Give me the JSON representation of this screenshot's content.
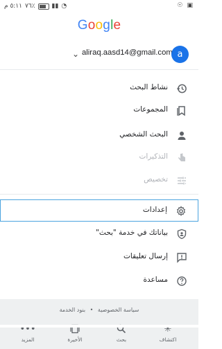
{
  "status_bar": {
    "time_label": "٥:١١ م",
    "battery_label": "٧٦٪"
  },
  "logo": {
    "letters": [
      "G",
      "o",
      "o",
      "g",
      "l",
      "e"
    ],
    "colors": [
      "#4285F4",
      "#EA4335",
      "#FBBC05",
      "#4285F4",
      "#34A853",
      "#EA4335"
    ]
  },
  "account": {
    "email": "aliraq.aasd14@gmail.com",
    "avatar_letter": "a",
    "avatar_color": "#1a73e8"
  },
  "menu": [
    {
      "label": "نشاط البحث",
      "icon": "history-icon",
      "disabled": false
    },
    {
      "label": "المجموعات",
      "icon": "bookmark-icon",
      "disabled": false
    },
    {
      "label": "البحث الشخصي",
      "icon": "person-icon",
      "disabled": false
    },
    {
      "label": "التذكيرات",
      "icon": "reminder-hand-icon",
      "disabled": true
    },
    {
      "label": "تخصيص",
      "icon": "tune-icon",
      "disabled": true
    },
    {
      "label": "إعدادات",
      "icon": "gear-icon",
      "disabled": false,
      "selected": true
    },
    {
      "label": "بياناتك في خدمة \"بحث\"",
      "icon": "shield-person-icon",
      "disabled": false
    },
    {
      "label": "إرسال تعليقات",
      "icon": "feedback-icon",
      "disabled": false
    },
    {
      "label": "مساعدة",
      "icon": "help-icon",
      "disabled": false
    }
  ],
  "footer": {
    "privacy": "سياسة الخصوصية",
    "terms": "بنود الخدمة"
  },
  "bottom_nav": [
    {
      "label": "المزيد",
      "icon": "more-dots-icon"
    },
    {
      "label": "الأخيرة",
      "icon": "recent-icon"
    },
    {
      "label": "بحث",
      "icon": "search-icon"
    },
    {
      "label": "اكتشاف",
      "icon": "discover-icon"
    }
  ]
}
